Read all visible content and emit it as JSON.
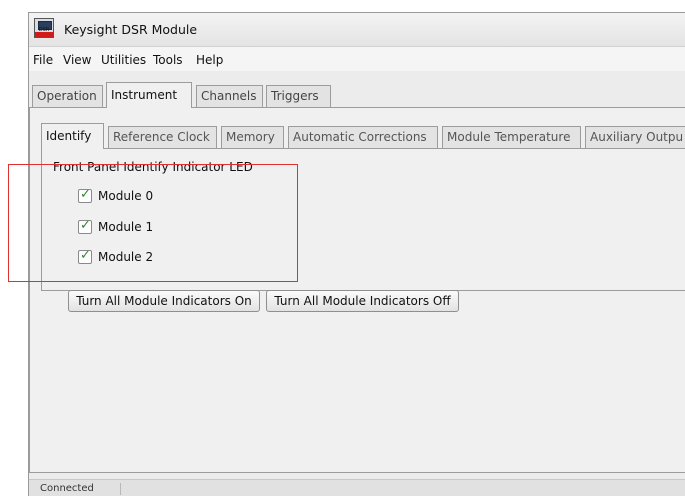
{
  "window": {
    "title": "Keysight DSR Module",
    "icon": "dsr-module-app-icon",
    "icon_text": "DSR"
  },
  "menu": {
    "items": [
      "File",
      "View",
      "Utilities",
      "Tools",
      "Help"
    ]
  },
  "outer_tabs": {
    "items": [
      "Operation",
      "Instrument",
      "Channels",
      "Triggers"
    ],
    "active": "Instrument"
  },
  "inner_tabs": {
    "items": [
      "Identify",
      "Reference Clock",
      "Memory",
      "Automatic Corrections",
      "Module Temperature",
      "Auxiliary Outpu"
    ],
    "active": "Identify"
  },
  "identify": {
    "group_label": "Front Panel Identify Indicator LED",
    "modules": [
      {
        "label": "Module 0",
        "checked": true
      },
      {
        "label": "Module 1",
        "checked": true
      },
      {
        "label": "Module 2",
        "checked": true
      }
    ],
    "check_glyph": "✓",
    "buttons": {
      "all_on": "Turn All Module Indicators On",
      "all_off": "Turn All Module Indicators Off"
    }
  },
  "status": {
    "text": "Connected"
  },
  "colors": {
    "highlight": "#e03030",
    "checkmark": "#2f8a2f",
    "icon_red": "#d21a1a"
  }
}
